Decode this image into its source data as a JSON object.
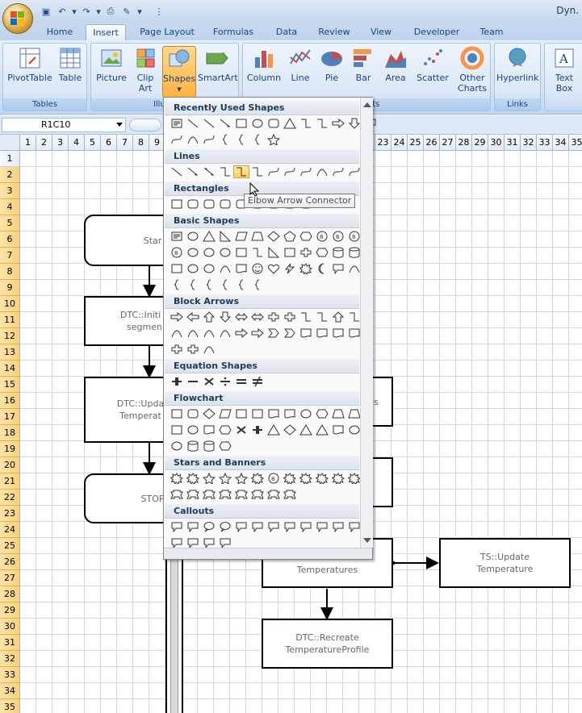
{
  "app": {
    "title": "Dyn."
  },
  "quick_access": [
    "save-icon",
    "undo-icon",
    "redo-icon",
    "print-icon",
    "format-painter-icon"
  ],
  "tabs": [
    "Home",
    "Insert",
    "Page Layout",
    "Formulas",
    "Data",
    "Review",
    "View",
    "Developer",
    "Team"
  ],
  "active_tab": "Insert",
  "ribbon": {
    "groups": [
      {
        "label": "Tables",
        "buttons": [
          "PivotTable",
          "Table"
        ]
      },
      {
        "label": "Illustr",
        "buttons": [
          "Picture",
          "Clip Art",
          "Shapes",
          "SmartArt"
        ]
      },
      {
        "label": "Charts",
        "buttons": [
          "Column",
          "Line",
          "Pie",
          "Bar",
          "Area",
          "Scatter",
          "Other Charts"
        ]
      },
      {
        "label": "Links",
        "buttons": [
          "Hyperlink"
        ]
      },
      {
        "label": "",
        "buttons": [
          "Text Box"
        ]
      }
    ],
    "pivot": "PivotTable",
    "table": "Table",
    "picture": "Picture",
    "clip_a": "Clip",
    "clip_b": "Art",
    "shapes": "Shapes",
    "smartart": "SmartArt",
    "column": "Column",
    "line": "Line",
    "pie": "Pie",
    "bar": "Bar",
    "area": "Area",
    "scatter": "Scatter",
    "other_a": "Other",
    "other_b": "Charts",
    "hyperlink": "Hyperlink",
    "text_a": "Text",
    "text_b": "Box",
    "g_tables": "Tables",
    "g_illus": "Illustr",
    "g_charts": "Charts",
    "g_links": "Links"
  },
  "name_box": "R1C10",
  "columns": [
    "1",
    "2",
    "3",
    "4",
    "5",
    "6",
    "7",
    "8",
    "9",
    "",
    "",
    "",
    "",
    "",
    "",
    "",
    "",
    "",
    "",
    "",
    "",
    "",
    "23",
    "24",
    "25",
    "26",
    "27",
    "28",
    "29",
    "30",
    "31",
    "32",
    "33",
    "34",
    "35"
  ],
  "rows": [
    "1",
    "2",
    "3",
    "4",
    "5",
    "6",
    "7",
    "8",
    "9",
    "10",
    "11",
    "12",
    "13",
    "14",
    "15",
    "16",
    "17",
    "18",
    "19",
    "20",
    "21",
    "22",
    "23",
    "24",
    "25",
    "26",
    "27",
    "28",
    "29",
    "30",
    "31",
    "32",
    "33",
    "34",
    "35"
  ],
  "flowchart": {
    "start": "Star",
    "init_a": "DTC::Initi",
    "init_b": "segmen",
    "update_a": "DTC::Upda",
    "update_b": "Temperat",
    "stop": "STOP",
    "ds": "ds",
    "temps": "Temperatures",
    "ts_a": "TS::Update",
    "ts_b": "Temperature",
    "recreate_a": "DTC::Recreate",
    "recreate_b": "TemperatureProfile"
  },
  "gallery": {
    "sections": [
      "Recently Used Shapes",
      "Lines",
      "Rectangles",
      "Basic Shapes",
      "Block Arrows",
      "Equation Shapes",
      "Flowchart",
      "Stars and Banners",
      "Callouts"
    ],
    "tooltip": "Elbow Arrow Connector"
  }
}
